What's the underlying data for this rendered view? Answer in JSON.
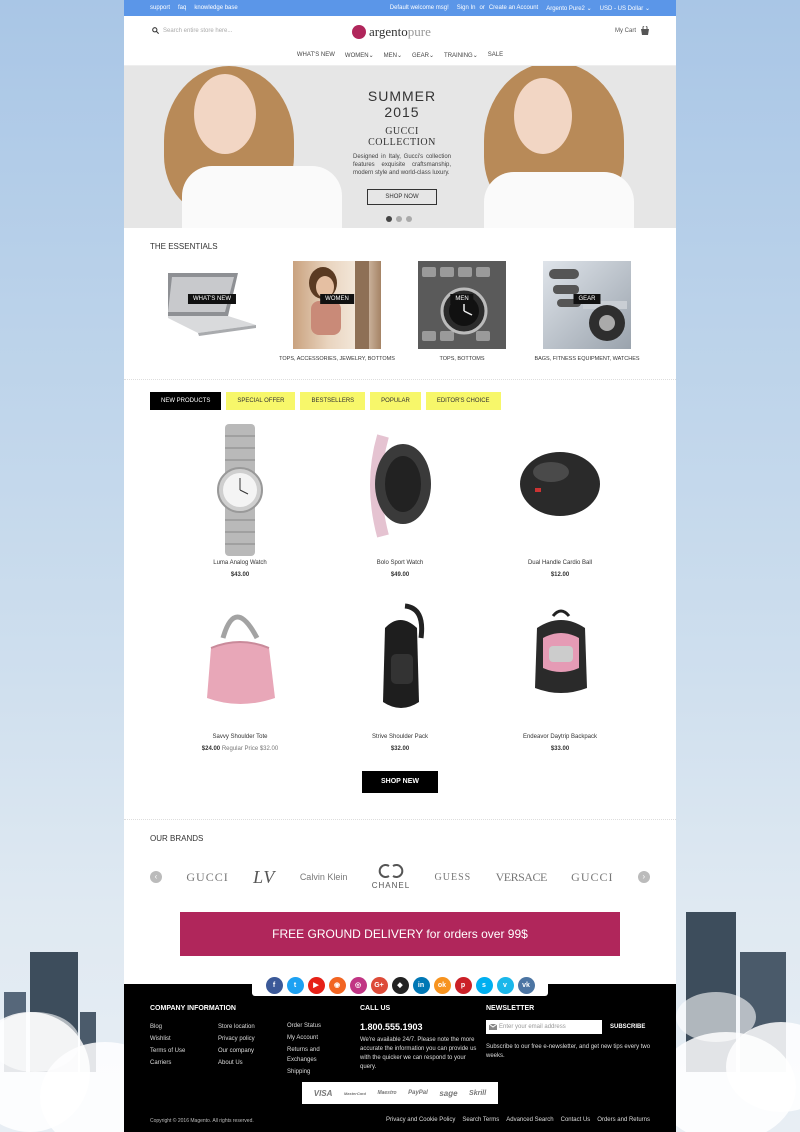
{
  "topbar": {
    "left_links": [
      "support",
      "faq",
      "knowledge base"
    ],
    "welcome": "Default welcome msg!",
    "sign_in": "Sign In",
    "or": "or",
    "create_account": "Create an Account",
    "store": "Argento Pure2",
    "currency": "USD - US Dollar"
  },
  "header": {
    "search_placeholder": "Search entire store here...",
    "logo_part1": "argento",
    "logo_part2": "pure",
    "cart_label": "My Cart"
  },
  "nav": [
    "WHAT'S NEW",
    "WOMEN",
    "MEN",
    "GEAR",
    "TRAINING",
    "SALE"
  ],
  "hero": {
    "title": "SUMMER 2015",
    "subtitle": "GUCCI COLLECTION",
    "description": "Designed in Italy, Gucci's collection features exquisite craftsmanship, modern style and world-class luxury.",
    "button": "SHOP NOW"
  },
  "essentials": {
    "title": "THE ESSENTIALS",
    "items": [
      {
        "label": "WHAT'S NEW",
        "caption": ""
      },
      {
        "label": "WOMEN",
        "caption": "TOPS, ACCESSORIES, JEWELRY, BOTTOMS"
      },
      {
        "label": "MEN",
        "caption": "TOPS, BOTTOMS"
      },
      {
        "label": "GEAR",
        "caption": "BAGS, FITNESS EQUIPMENT, WATCHES"
      }
    ]
  },
  "tabs": [
    "NEW PRODUCTS",
    "SPECIAL OFFER",
    "BESTSELLERS",
    "POPULAR",
    "EDITOR'S CHOICE"
  ],
  "products": [
    {
      "name": "Luma Analog Watch",
      "price": "$43.00",
      "regular": ""
    },
    {
      "name": "Bolo Sport Watch",
      "price": "$49.00",
      "regular": ""
    },
    {
      "name": "Dual Handle Cardio Ball",
      "price": "$12.00",
      "regular": ""
    },
    {
      "name": "Savvy Shoulder Tote",
      "price": "$24.00",
      "regular": "Regular Price $32.00"
    },
    {
      "name": "Strive Shoulder Pack",
      "price": "$32.00",
      "regular": ""
    },
    {
      "name": "Endeavor Daytrip Backpack",
      "price": "$33.00",
      "regular": ""
    }
  ],
  "shop_new": "SHOP NEW",
  "brands": {
    "title": "OUR BRANDS",
    "items": [
      "GUCCI",
      "LV",
      "Calvin Klein",
      "CHANEL",
      "GUESS",
      "VERSACE",
      "GUCCI"
    ]
  },
  "delivery_banner": "FREE GROUND DELIVERY for orders over 99$",
  "social": [
    {
      "name": "facebook",
      "glyph": "f",
      "color": "#3b5998"
    },
    {
      "name": "twitter",
      "glyph": "t",
      "color": "#1da1f2"
    },
    {
      "name": "youtube",
      "glyph": "▶",
      "color": "#e62117"
    },
    {
      "name": "rss",
      "glyph": "◉",
      "color": "#f26522"
    },
    {
      "name": "instagram",
      "glyph": "◎",
      "color": "#c13584"
    },
    {
      "name": "google-plus",
      "glyph": "G+",
      "color": "#dd4b39"
    },
    {
      "name": "github",
      "glyph": "◆",
      "color": "#222222"
    },
    {
      "name": "linkedin",
      "glyph": "in",
      "color": "#0077b5"
    },
    {
      "name": "odnoklassniki",
      "glyph": "ok",
      "color": "#f7931e"
    },
    {
      "name": "pinterest",
      "glyph": "p",
      "color": "#cb2027"
    },
    {
      "name": "skype",
      "glyph": "s",
      "color": "#00aff0"
    },
    {
      "name": "vimeo",
      "glyph": "v",
      "color": "#1ab7ea"
    },
    {
      "name": "vk",
      "glyph": "vk",
      "color": "#4c75a3"
    }
  ],
  "footer": {
    "company_title": "COMPANY INFORMATION",
    "col1": [
      "Blog",
      "Wishlist",
      "Terms of Use",
      "Carriers"
    ],
    "col2": [
      "Store location",
      "Privacy policy",
      "Our company",
      "About Us"
    ],
    "col3": [
      "Order Status",
      "My Account",
      "Returns and Exchanges",
      "Shipping"
    ],
    "call_title": "CALL US",
    "phone": "1.800.555.1903",
    "call_desc": "We're available 24/7. Please note the more accurate the information you can provide us with the quicker we can respond to your query.",
    "newsletter_title": "NEWSLETTER",
    "newsletter_placeholder": "Enter your email address",
    "subscribe": "SUBSCRIBE",
    "newsletter_desc": "Subscribe to our free e-newsletter, and get new tips every two weeks.",
    "payments": [
      "VISA",
      "MasterCard",
      "Maestro",
      "PayPal",
      "sage",
      "Skrill"
    ],
    "copyright": "Copyright © 2016 Magento. All rights reserved.",
    "bottom_links": [
      "Privacy and Cookie Policy",
      "Search Terms",
      "Advanced Search",
      "Contact Us",
      "Orders and Returns"
    ]
  }
}
